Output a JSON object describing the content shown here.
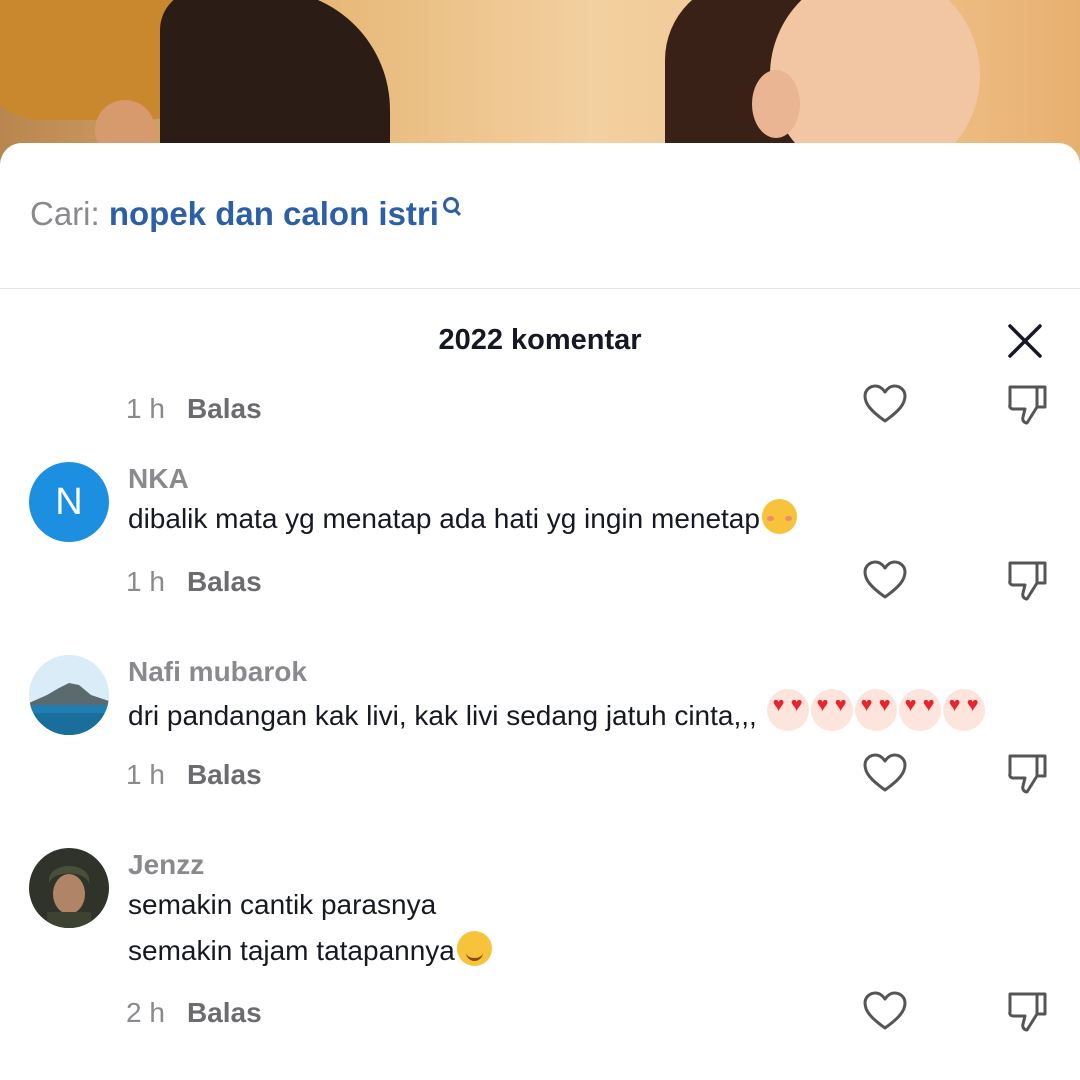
{
  "search": {
    "prefix": "Cari:",
    "term": "nopek dan calon istri"
  },
  "header": {
    "count_label": "2022 komentar"
  },
  "top_meta": {
    "time": "1 h",
    "reply": "Balas"
  },
  "comments": [
    {
      "username": "NKA",
      "avatar_letter": "N",
      "text": [
        "dibalik mata yg menatap ada hati yg ingin menetap"
      ],
      "emoji": "smiling-face-icon",
      "time": "1 h",
      "reply": "Balas"
    },
    {
      "username": "Nafi mubarok",
      "text": [
        "dri pandangan kak livi, kak livi sedang jatuh cinta,,,"
      ],
      "emoji": "heart-eyes-icon x5",
      "time": "1 h",
      "reply": "Balas"
    },
    {
      "username": "Jenzz",
      "text": [
        "semakin cantik parasnya",
        "semakin tajam tatapannya"
      ],
      "emoji": "winking-face-icon",
      "time": "2 h",
      "reply": "Balas"
    }
  ],
  "icons": {
    "like": "heart-outline-icon",
    "dislike": "thumbs-down-outline-icon",
    "close": "close-icon",
    "search": "search-icon"
  },
  "colors": {
    "link": "#2d5fa6",
    "avatar_bg": "#1d8fe1",
    "text": "#161823",
    "muted": "#8a8a8e"
  }
}
